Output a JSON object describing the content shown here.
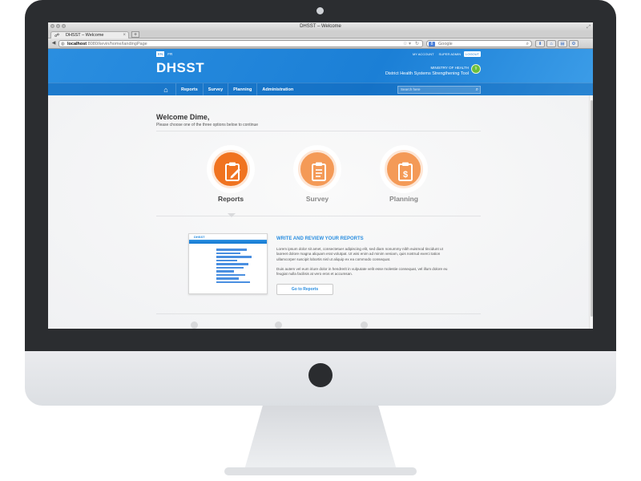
{
  "browser": {
    "window_title": "DHSST – Welcome",
    "tab_title": "DHSST – Welcome",
    "url_host": "localhost",
    "url_path": ":8080/kevin/home/landingPage",
    "search_placeholder": "Google"
  },
  "header": {
    "languages": [
      "EN",
      "FR"
    ],
    "account_links": [
      "MY ACCOUNT",
      "SUPER ADMIN",
      "LOGOUT"
    ],
    "logo": "DHSST",
    "ministry": "MINISTRY OF HEALTH",
    "tool_name": "District Health Systems Strengthening Tool",
    "nav_items": [
      "Reports",
      "Survey",
      "Planning",
      "Administration"
    ],
    "search_placeholder": "Search here"
  },
  "welcome": {
    "title": "Welcome Dime,",
    "subtitle": "Please choose one of the three options below to continue"
  },
  "options": [
    {
      "label": "Reports",
      "icon": "clipboard-pen-icon",
      "active": true
    },
    {
      "label": "Survey",
      "icon": "clipboard-list-icon",
      "active": false
    },
    {
      "label": "Planning",
      "icon": "clipboard-dollar-icon",
      "active": false
    }
  ],
  "panel": {
    "title": "WRITE AND REVIEW YOUR REPORTS",
    "p1": "Lorem ipsum dolor sit amet, consectetuer adipiscing elit, sed diam nonummy nibh euismod tincidunt ut laoreet dolore magna aliquam erat volutpat. Ut wisi enim ad minim veniam, quis nostrud exerci tation ullamcorper suscipit lobortis nisl ut aliquip ex ea commodo consequat.",
    "p2": "Duis autem vel eum iriure dolor in hendrerit in vulputate velit esse molestie consequat, vel illum dolore eu feugiat nulla facilisis at vero eros et accumsan.",
    "button": "Go to Reports",
    "thumb_logo": "DHSST"
  },
  "colors": {
    "brand_blue": "#1b7fd6",
    "accent_orange": "#f07320",
    "accent_orange_light": "#f49a57"
  }
}
